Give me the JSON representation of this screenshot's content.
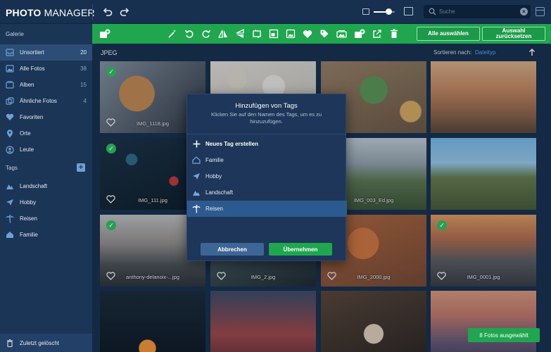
{
  "app": {
    "title_bold": "PHOTO",
    "title_rest": " MANAGER"
  },
  "search": {
    "placeholder": "Suche"
  },
  "zoom": {
    "value": 0.7
  },
  "sidebar": {
    "gallery_label": "Galerie",
    "items": [
      {
        "label": "Unsortiert",
        "count": "20",
        "icon": "inbox-icon"
      },
      {
        "label": "Alle Fotos",
        "count": "38",
        "icon": "photos-icon"
      },
      {
        "label": "Alben",
        "count": "15",
        "icon": "albums-icon"
      },
      {
        "label": "Ähnliche Fotos",
        "count": "4",
        "icon": "similar-photos-icon"
      },
      {
        "label": "Favoriten",
        "count": "",
        "icon": "heart-icon"
      },
      {
        "label": "Orte",
        "count": "",
        "icon": "location-pin-icon"
      },
      {
        "label": "Leute",
        "count": "",
        "icon": "person-icon"
      }
    ],
    "tags_label": "Tags",
    "tags_add": "+",
    "tags": [
      {
        "label": "Landschaft",
        "icon": "landscape-icon"
      },
      {
        "label": "Hobby",
        "icon": "paper-plane-icon"
      },
      {
        "label": "Reisen",
        "icon": "palm-tree-icon"
      },
      {
        "label": "Familie",
        "icon": "house-icon"
      }
    ],
    "bottom_label": "Zuletzt gelöscht"
  },
  "toolbar": {
    "select_all": "Alle auswählen",
    "reset_selection": "Auswahl zurücksetzen"
  },
  "content": {
    "group_label": "JPEG",
    "sort_label": "Sortieren nach:",
    "sort_value": "Dateityp",
    "sort_dir": "↑"
  },
  "tiles": [
    {
      "name": "IMG_1118.jpg",
      "selected": true
    },
    {
      "name": "",
      "selected": false
    },
    {
      "name": "",
      "selected": false
    },
    {
      "name": "",
      "selected": false
    },
    {
      "name": "IMG_111.jpg",
      "selected": true
    },
    {
      "name": "",
      "selected": false
    },
    {
      "name": "IMG_003_Ed.jpg",
      "selected": true
    },
    {
      "name": "",
      "selected": true
    },
    {
      "name": "anthony-delanoix-...jpg",
      "selected": true
    },
    {
      "name": "IMG_2.jpg",
      "selected": true
    },
    {
      "name": "IMG_2000.jpg",
      "selected": true
    },
    {
      "name": "IMG_0001.jpg",
      "selected": true
    },
    {
      "name": "",
      "selected": false
    },
    {
      "name": "",
      "selected": false
    },
    {
      "name": "",
      "selected": false
    },
    {
      "name": "",
      "selected": false
    }
  ],
  "modal": {
    "title": "Hinzufügen von Tags",
    "hint": "Klicken Sie auf den Namen des Tags, um es zu hinzuzufügen.",
    "new_tag": "Neues Tag erstellen",
    "items": [
      {
        "label": "Familie",
        "icon": "house-icon"
      },
      {
        "label": "Hobby",
        "icon": "paper-plane-icon"
      },
      {
        "label": "Landschaft",
        "icon": "landscape-icon"
      },
      {
        "label": "Reisen",
        "icon": "palm-tree-icon"
      }
    ],
    "active_index": 3,
    "cancel": "Abbrechen",
    "ok": "Übernehmen"
  },
  "selection": {
    "count_label": "8 Fotos ausgewählt"
  }
}
